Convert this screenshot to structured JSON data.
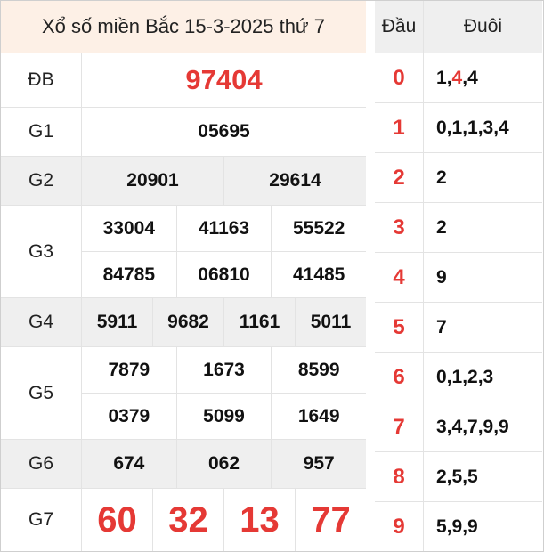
{
  "title": "Xổ số miền Bắc 15-3-2025 thứ 7",
  "prizes": [
    {
      "label": "ĐB",
      "rows": [
        [
          "97404"
        ]
      ]
    },
    {
      "label": "G1",
      "rows": [
        [
          "05695"
        ]
      ]
    },
    {
      "label": "G2",
      "rows": [
        [
          "20901",
          "29614"
        ]
      ]
    },
    {
      "label": "G3",
      "rows": [
        [
          "33004",
          "41163",
          "55522"
        ],
        [
          "84785",
          "06810",
          "41485"
        ]
      ]
    },
    {
      "label": "G4",
      "rows": [
        [
          "5911",
          "9682",
          "1161",
          "5011"
        ]
      ]
    },
    {
      "label": "G5",
      "rows": [
        [
          "7879",
          "1673",
          "8599"
        ],
        [
          "0379",
          "5099",
          "1649"
        ]
      ]
    },
    {
      "label": "G6",
      "rows": [
        [
          "674",
          "062",
          "957"
        ]
      ]
    },
    {
      "label": "G7",
      "rows": [
        [
          "60",
          "32",
          "13",
          "77"
        ]
      ]
    }
  ],
  "loto": {
    "head_label": "Đầu",
    "tail_label": "Đuôi",
    "rows": [
      {
        "head": "0",
        "tails": [
          {
            "d": "1"
          },
          {
            "d": ","
          },
          {
            "d": "4",
            "highlight": true
          },
          {
            "d": ","
          },
          {
            "d": "4"
          }
        ]
      },
      {
        "head": "1",
        "tails": [
          {
            "d": "0,1,1,3,4"
          }
        ]
      },
      {
        "head": "2",
        "tails": [
          {
            "d": "2"
          }
        ]
      },
      {
        "head": "3",
        "tails": [
          {
            "d": "2"
          }
        ]
      },
      {
        "head": "4",
        "tails": [
          {
            "d": "9"
          }
        ]
      },
      {
        "head": "5",
        "tails": [
          {
            "d": "7"
          }
        ]
      },
      {
        "head": "6",
        "tails": [
          {
            "d": "0,1,2,3"
          }
        ]
      },
      {
        "head": "7",
        "tails": [
          {
            "d": "3,4,7,9,9"
          }
        ]
      },
      {
        "head": "8",
        "tails": [
          {
            "d": "2,5,5"
          }
        ]
      },
      {
        "head": "9",
        "tails": [
          {
            "d": "5,9,9"
          }
        ]
      }
    ]
  },
  "colors": {
    "accent": "#e53935",
    "header_bg": "#fdf0e6",
    "shade": "#efefef"
  }
}
